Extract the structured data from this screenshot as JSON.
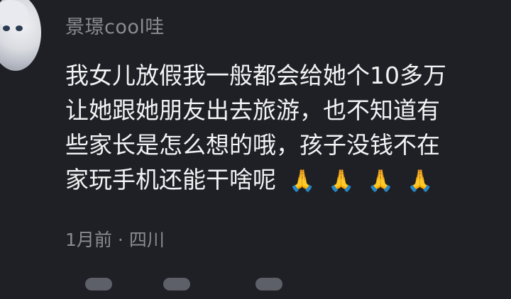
{
  "comment": {
    "username": "景璟cool哇",
    "lines": [
      "我女儿放假我一般都会给她个10多万",
      "让她跟她朋友出去旅游，也不知道有",
      "些家长是怎么想的哦，孩子没钱不在",
      "家玩手机还能干啥呢"
    ],
    "emoji": [
      "🙏",
      "🙏",
      "🙏",
      "🙏"
    ],
    "time": "1月前",
    "separator": "·",
    "location": "四川"
  },
  "icons": [
    "avatar-image",
    "pray-emoji"
  ]
}
